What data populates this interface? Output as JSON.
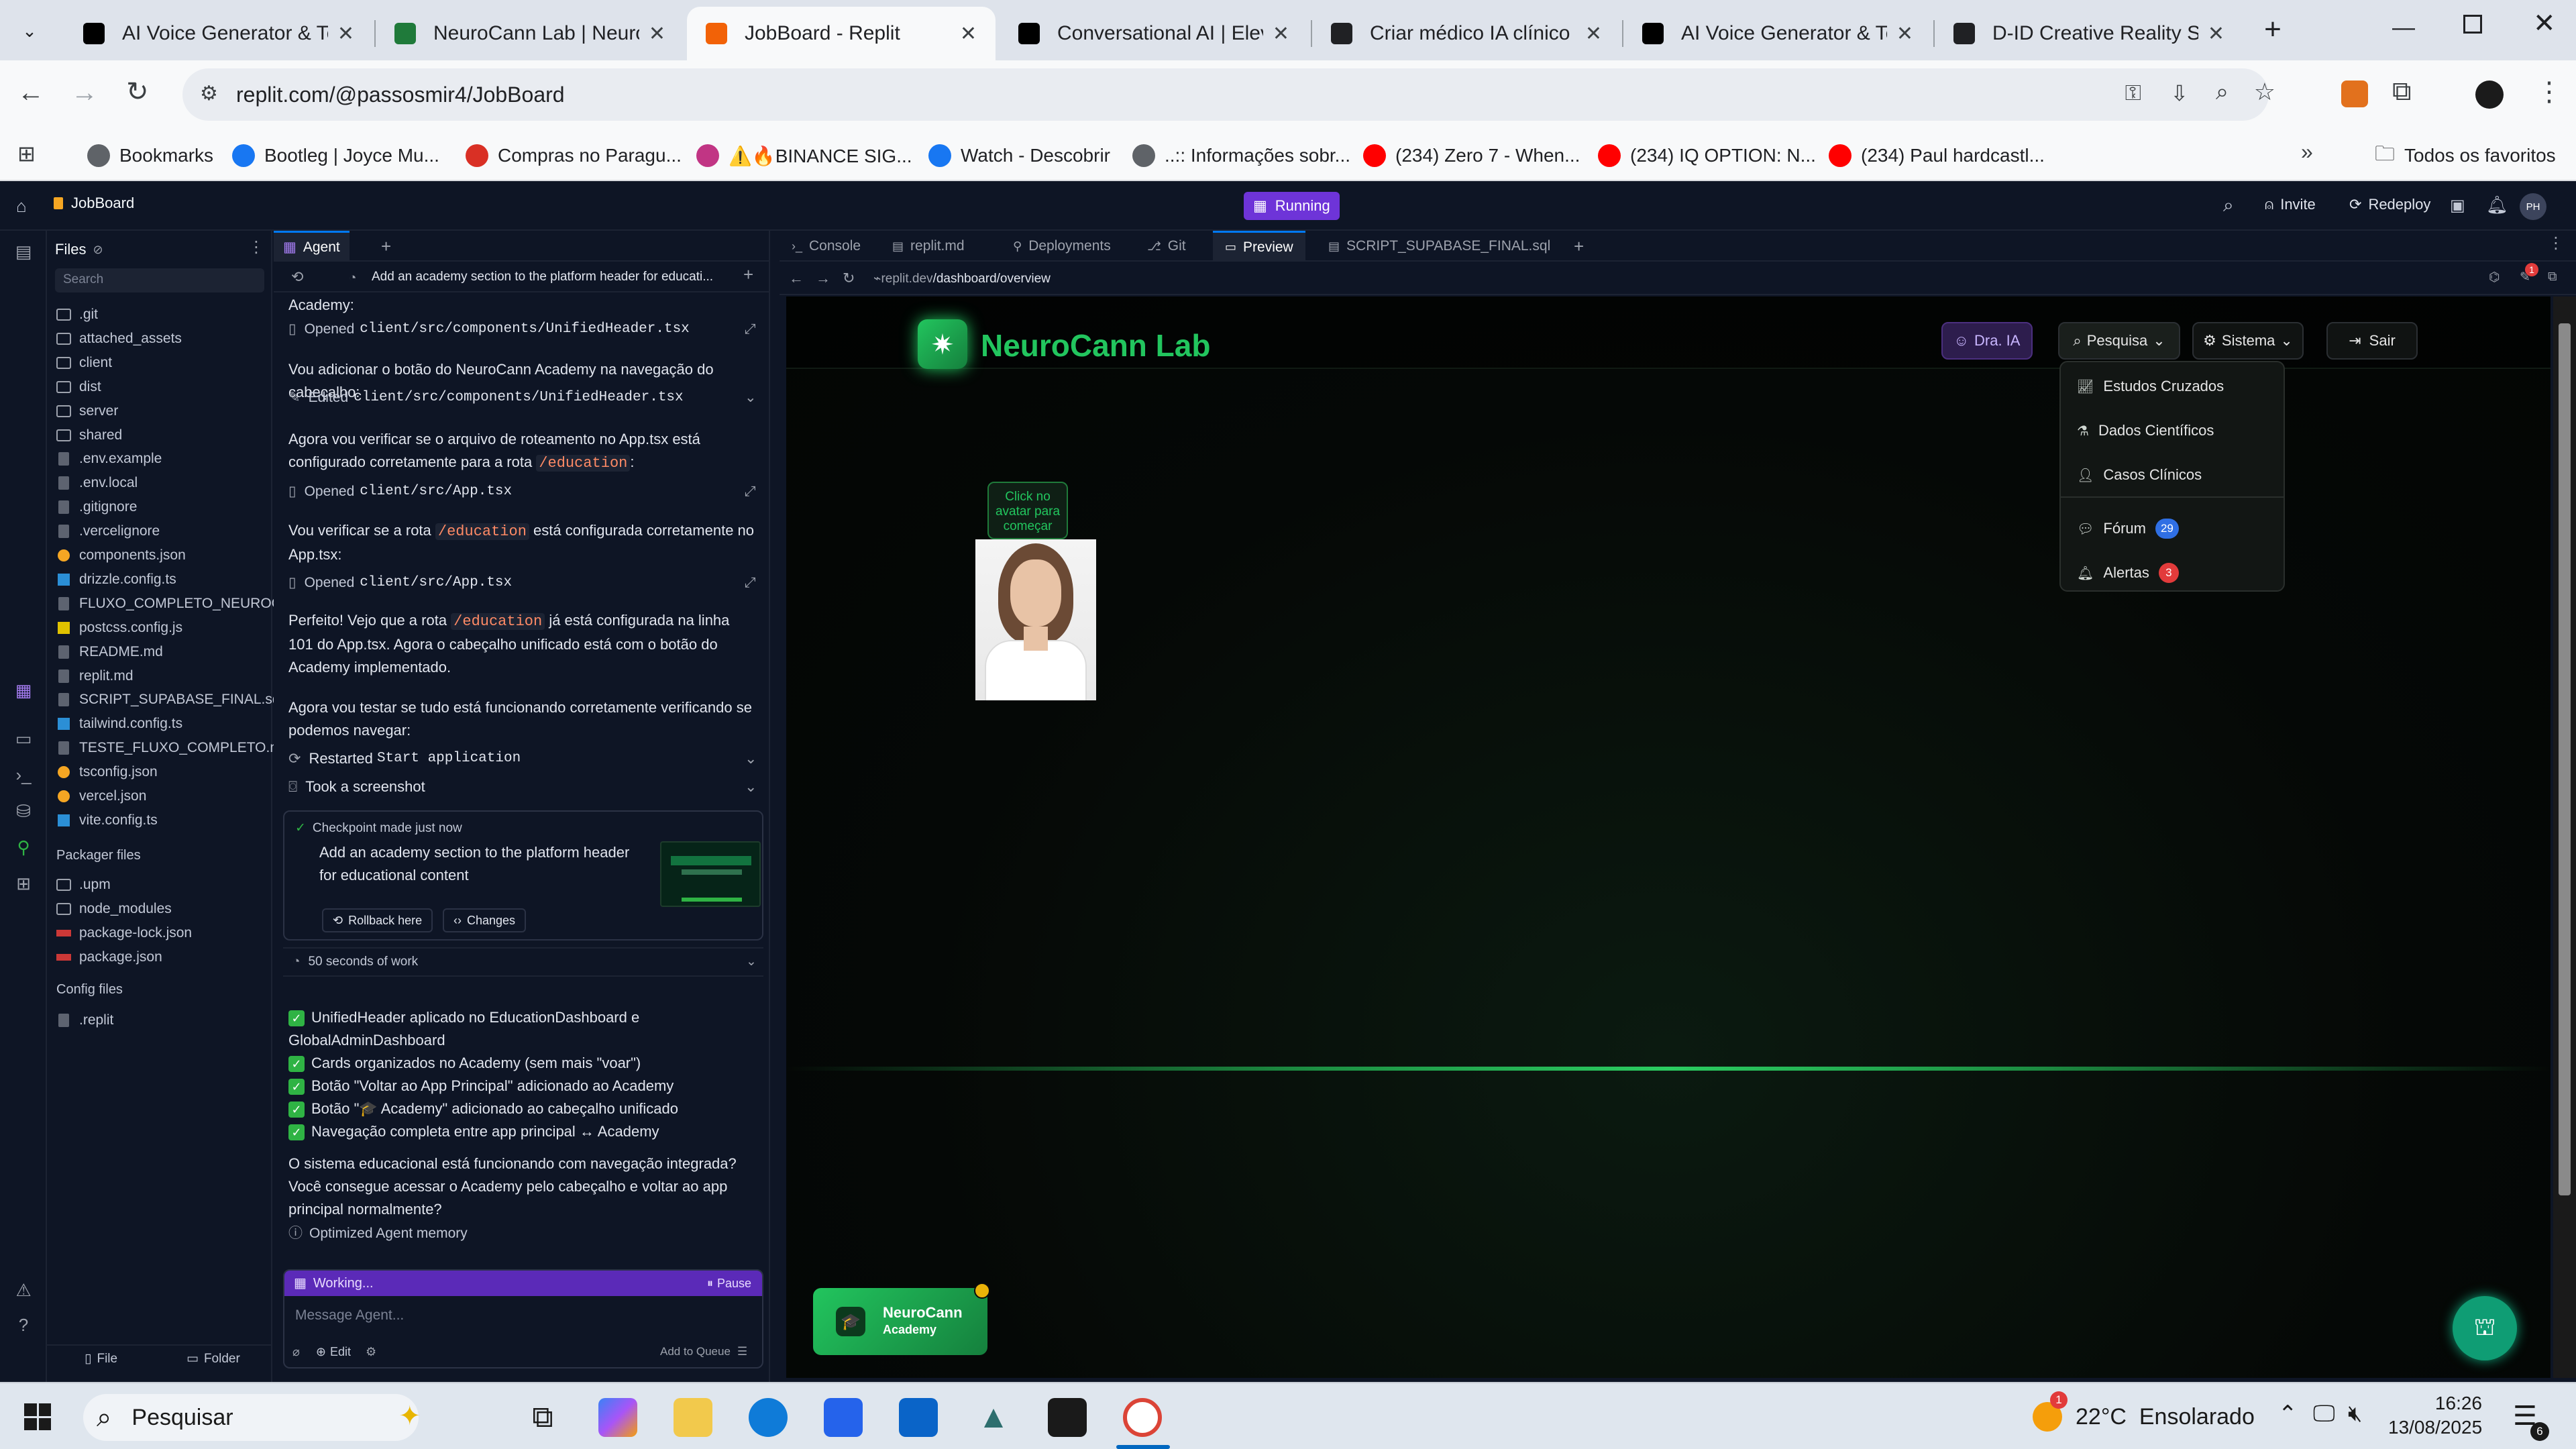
{
  "browser": {
    "tabs": [
      {
        "title": "AI Voice Generator & Text",
        "icon": "elevenlabs-icon",
        "color": "#000000"
      },
      {
        "title": "NeuroCann Lab | NeuroCa",
        "icon": "neurocann-icon",
        "color": "#1f7a3a"
      },
      {
        "title": "JobBoard - Replit",
        "icon": "replit-icon",
        "color": "#f26207"
      },
      {
        "title": "Conversational AI | Eleven",
        "icon": "elevenlabs-icon",
        "color": "#000000"
      },
      {
        "title": "Criar médico IA clínico",
        "icon": "openai-icon",
        "color": "#202124"
      },
      {
        "title": "AI Voice Generator & Text",
        "icon": "elevenlabs-icon",
        "color": "#000000"
      },
      {
        "title": "D-ID Creative Reality Stud",
        "icon": "did-icon",
        "color": "#202124"
      }
    ],
    "active_tab": 2,
    "url": "replit.com/@passosmir4/JobBoard",
    "bookmarks": [
      {
        "label": "Bookmarks",
        "icon": "star-icon",
        "color": "#5f6368"
      },
      {
        "label": "Bootleg | Joyce Mu...",
        "icon": "facebook-icon",
        "color": "#1877f2"
      },
      {
        "label": "Compras no Paragu...",
        "icon": "pin-icon",
        "color": "#d93025"
      },
      {
        "label": "⚠️🔥BINANCE SIG...",
        "icon": "instagram-icon",
        "color": "#c13584"
      },
      {
        "label": "Watch - Descobrir",
        "icon": "facebook-icon",
        "color": "#1877f2"
      },
      {
        "label": "..:: Informações sobr...",
        "icon": "globe-icon",
        "color": "#5f6368"
      },
      {
        "label": "(234) Zero 7 - When...",
        "icon": "youtube-icon",
        "color": "#ff0000"
      },
      {
        "label": "(234) IQ OPTION: N...",
        "icon": "youtube-icon",
        "color": "#ff0000"
      },
      {
        "label": "(234) Paul hardcastl...",
        "icon": "youtube-icon",
        "color": "#ff0000"
      }
    ],
    "all_bookmarks": "Todos os favoritos"
  },
  "replit": {
    "project": "JobBoard",
    "status": "Running",
    "invite": "Invite",
    "redeploy": "Redeploy",
    "avatar_initials": "PH"
  },
  "files": {
    "title": "Files",
    "search_placeholder": "Search",
    "items": [
      {
        "name": ".git",
        "type": "folder"
      },
      {
        "name": "attached_assets",
        "type": "folder"
      },
      {
        "name": "client",
        "type": "folder"
      },
      {
        "name": "dist",
        "type": "folder"
      },
      {
        "name": "server",
        "type": "folder"
      },
      {
        "name": "shared",
        "type": "folder"
      },
      {
        "name": ".env.example",
        "type": "file"
      },
      {
        "name": ".env.local",
        "type": "file"
      },
      {
        "name": ".gitignore",
        "type": "file"
      },
      {
        "name": ".vercelignore",
        "type": "file"
      },
      {
        "name": "components.json",
        "type": "json"
      },
      {
        "name": "drizzle.config.ts",
        "type": "ts"
      },
      {
        "name": "FLUXO_COMPLETO_NEUROC...",
        "type": "file"
      },
      {
        "name": "postcss.config.js",
        "type": "js"
      },
      {
        "name": "README.md",
        "type": "file"
      },
      {
        "name": "replit.md",
        "type": "file"
      },
      {
        "name": "SCRIPT_SUPABASE_FINAL.sql",
        "type": "file"
      },
      {
        "name": "tailwind.config.ts",
        "type": "ts"
      },
      {
        "name": "TESTE_FLUXO_COMPLETO.md",
        "type": "file"
      },
      {
        "name": "tsconfig.json",
        "type": "json"
      },
      {
        "name": "vercel.json",
        "type": "json"
      },
      {
        "name": "vite.config.ts",
        "type": "ts"
      }
    ],
    "packager_title": "Packager files",
    "packager_items": [
      {
        "name": ".upm",
        "type": "folder"
      },
      {
        "name": "node_modules",
        "type": "folder"
      },
      {
        "name": "package-lock.json",
        "type": "npm"
      },
      {
        "name": "package.json",
        "type": "npm"
      }
    ],
    "config_title": "Config files",
    "config_items": [
      {
        "name": ".replit",
        "type": "file"
      }
    ],
    "file_button": "File",
    "folder_button": "Folder"
  },
  "agent": {
    "tab_label": "Agent",
    "header_title": "Add an academy section to the platform header for educati...",
    "cutoff_text": "Academy:",
    "messages": [
      {
        "kind": "action",
        "verb": "Opened",
        "path": "client/src/components/UnifiedHeader.tsx"
      },
      {
        "kind": "text",
        "text": "Vou adicionar o botão do NeuroCann Academy na navegação do cabeçalho:"
      },
      {
        "kind": "action",
        "verb": "Edited",
        "path": "client/src/components/UnifiedHeader.tsx"
      },
      {
        "kind": "text2",
        "pre": "Agora vou verificar se o arquivo de roteamento no App.tsx está configurado corretamente para a rota ",
        "code": "/education",
        "post": ":"
      },
      {
        "kind": "action",
        "verb": "Opened",
        "path": "client/src/App.tsx"
      },
      {
        "kind": "text2",
        "pre": "Vou verificar se a rota ",
        "code": "/education",
        "post": " está configurada corretamente no App.tsx:"
      },
      {
        "kind": "action",
        "verb": "Opened",
        "path": "client/src/App.tsx"
      },
      {
        "kind": "text2",
        "pre": "Perfeito! Vejo que a rota ",
        "code": "/education",
        "post": " já está configurada na linha 101 do App.tsx. Agora o cabeçalho unificado está com o botão do Academy implementado."
      },
      {
        "kind": "text",
        "text": "Agora vou testar se tudo está funcionando corretamente verificando se podemos navegar:"
      }
    ],
    "restarted_label": "Restarted",
    "restarted_value": "Start application",
    "screenshot_label": "Took a screenshot",
    "checkpoint": {
      "title": "Checkpoint made just now",
      "desc": "Add an academy section to the platform header for educational content",
      "rollback": "Rollback here",
      "changes": "Changes"
    },
    "work_time": "50 seconds of work",
    "checklist": [
      "UnifiedHeader aplicado no EducationDashboard e GlobalAdminDashboard",
      "Cards organizados no Academy (sem mais \"voar\")",
      "Botão \"Voltar ao App Principal\" adicionado ao Academy",
      "Botão \"🎓 Academy\" adicionado ao cabeçalho unificado",
      "Navegação completa entre app principal ↔ Academy"
    ],
    "final_text": "O sistema educacional está funcionando com navegação integrada? Você consegue acessar o Academy pelo cabeçalho e voltar ao app principal normalmente?",
    "memory": "Optimized Agent memory",
    "working": "Working...",
    "pause": "Pause",
    "input_placeholder": "Message Agent...",
    "edit": "Edit",
    "add_queue": "Add to Queue"
  },
  "preview": {
    "tabs": [
      "Console",
      "replit.md",
      "Deployments",
      "Git",
      "Preview",
      "SCRIPT_SUPABASE_FINAL.sql"
    ],
    "active": 4,
    "url_host": "replit.dev",
    "url_path": "/dashboard/overview",
    "notif_count": "1",
    "app": {
      "brand": "NeuroCann Lab",
      "dra": "Dra. IA",
      "pesquisa": "Pesquisa",
      "sistema": "Sistema",
      "sair": "Sair",
      "avatar_hint": "Click no avatar para começar",
      "menu": [
        {
          "label": "Estudos Cruzados",
          "icon": "chart-icon"
        },
        {
          "label": "Dados Científicos",
          "icon": "flask-icon"
        },
        {
          "label": "Casos Clínicos",
          "icon": "user-icon"
        },
        {
          "label": "Fórum",
          "icon": "chat-icon",
          "badge": "29",
          "badge_color": "#2f6fe4"
        },
        {
          "label": "Alertas",
          "icon": "bell-icon",
          "badge": "3",
          "badge_color": "#e23b3b"
        }
      ],
      "academy_line1": "NeuroCann",
      "academy_line2": "Academy",
      "accent": "#22c55e"
    }
  },
  "taskbar": {
    "search": "Pesquisar",
    "weather": "22°C  Ensolarado",
    "weather_badge": "1",
    "time": "16:26",
    "date": "13/08/2025",
    "notif": "6"
  }
}
